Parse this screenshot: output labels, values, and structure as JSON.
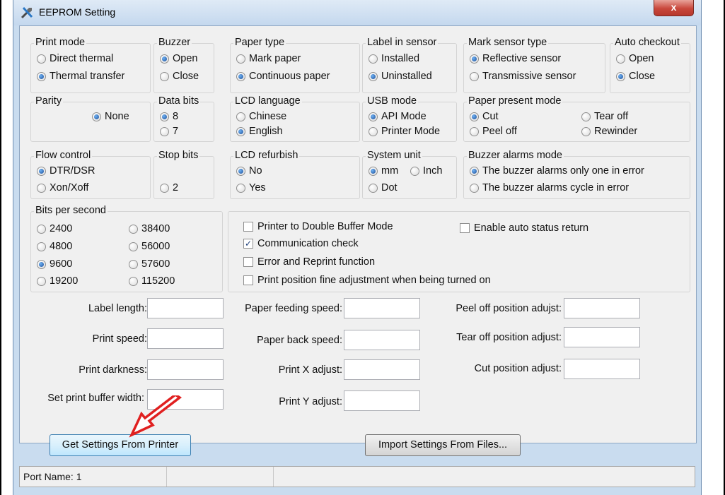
{
  "window": {
    "title": "EEPROM Setting",
    "close_symbol": "x"
  },
  "print_mode": {
    "label": "Print mode",
    "options": [
      {
        "label": "Direct thermal",
        "selected": false
      },
      {
        "label": "Thermal transfer",
        "selected": true
      }
    ]
  },
  "buzzer": {
    "label": "Buzzer",
    "options": [
      {
        "label": "Open",
        "selected": true
      },
      {
        "label": "Close",
        "selected": false
      }
    ]
  },
  "paper_type": {
    "label": "Paper type",
    "options": [
      {
        "label": "Mark paper",
        "selected": false
      },
      {
        "label": "Continuous paper",
        "selected": true
      }
    ]
  },
  "label_in_sensor": {
    "label": "Label in sensor",
    "options": [
      {
        "label": "Installed",
        "selected": false
      },
      {
        "label": "Uninstalled",
        "selected": true
      }
    ]
  },
  "mark_sensor_type": {
    "label": "Mark sensor type",
    "options": [
      {
        "label": "Reflective sensor",
        "selected": true
      },
      {
        "label": "Transmissive sensor",
        "selected": false
      }
    ]
  },
  "auto_checkout": {
    "label": "Auto checkout",
    "options": [
      {
        "label": "Open",
        "selected": false
      },
      {
        "label": "Close",
        "selected": true
      }
    ]
  },
  "parity": {
    "label": "Parity",
    "options": [
      {
        "label": "None",
        "selected": true
      }
    ]
  },
  "data_bits": {
    "label": "Data bits",
    "options": [
      {
        "label": "8",
        "selected": true
      },
      {
        "label": "7",
        "selected": false
      }
    ]
  },
  "lcd_language": {
    "label": "LCD language",
    "options": [
      {
        "label": "Chinese",
        "selected": false
      },
      {
        "label": "English",
        "selected": true
      }
    ]
  },
  "usb_mode": {
    "label": "USB mode",
    "options": [
      {
        "label": "API Mode",
        "selected": true
      },
      {
        "label": "Printer Mode",
        "selected": false
      }
    ]
  },
  "paper_present_mode": {
    "label": "Paper present mode",
    "options": [
      {
        "label": "Cut",
        "selected": true
      },
      {
        "label": "Tear off",
        "selected": false
      },
      {
        "label": "Peel off",
        "selected": false
      },
      {
        "label": "Rewinder",
        "selected": false
      }
    ]
  },
  "flow_control": {
    "label": "Flow control",
    "options": [
      {
        "label": "DTR/DSR",
        "selected": true
      },
      {
        "label": "Xon/Xoff",
        "selected": false
      }
    ]
  },
  "stop_bits": {
    "label": "Stop bits",
    "options": [
      {
        "label": "2",
        "selected": false
      }
    ]
  },
  "lcd_refurbish": {
    "label": "LCD refurbish",
    "options": [
      {
        "label": "No",
        "selected": true
      },
      {
        "label": "Yes",
        "selected": false
      }
    ]
  },
  "system_unit": {
    "label": "System unit",
    "options": [
      {
        "label": "mm",
        "selected": true
      },
      {
        "label": "Inch",
        "selected": false
      },
      {
        "label": "Dot",
        "selected": false
      }
    ]
  },
  "buzzer_alarms_mode": {
    "label": "Buzzer alarms mode",
    "options": [
      {
        "label": "The buzzer alarms only one in error",
        "selected": true
      },
      {
        "label": "The buzzer alarms cycle in error",
        "selected": false
      }
    ]
  },
  "bits_per_second": {
    "label": "Bits per second",
    "options": [
      {
        "label": "2400",
        "selected": false
      },
      {
        "label": "38400",
        "selected": false
      },
      {
        "label": "4800",
        "selected": false
      },
      {
        "label": "56000",
        "selected": false
      },
      {
        "label": "9600",
        "selected": true
      },
      {
        "label": "57600",
        "selected": false
      },
      {
        "label": "19200",
        "selected": false
      },
      {
        "label": "115200",
        "selected": false
      }
    ]
  },
  "checkboxes": [
    {
      "label": "Printer to Double Buffer Mode",
      "checked": false
    },
    {
      "label": "Enable auto status return",
      "checked": false
    },
    {
      "label": "Communication check",
      "checked": true
    },
    {
      "label": "Error and Reprint function",
      "checked": false
    },
    {
      "label": "Print position fine adjustment when being turned on",
      "checked": false
    }
  ],
  "fields": [
    {
      "label": "Label length:",
      "value": ""
    },
    {
      "label": "Print speed:",
      "value": ""
    },
    {
      "label": "Print darkness:",
      "value": ""
    },
    {
      "label": "Set print buffer width:",
      "value": ""
    },
    {
      "label": "Paper feeding speed:",
      "value": ""
    },
    {
      "label": "Paper back speed:",
      "value": ""
    },
    {
      "label": "Print X adjust:",
      "value": ""
    },
    {
      "label": "Print Y adjust:",
      "value": ""
    },
    {
      "label": "Peel off position adujst:",
      "value": ""
    },
    {
      "label": "Tear off position adjust:",
      "value": ""
    },
    {
      "label": "Cut position adjust:",
      "value": ""
    }
  ],
  "buttons": {
    "get_settings": "Get Settings From Printer",
    "import_settings": "Import Settings From Files..."
  },
  "status": {
    "port": "Port Name: 1"
  },
  "colors": {
    "arrow": "#e02020",
    "title_bar": "#c9dcef",
    "close_button": "#c9473b"
  }
}
